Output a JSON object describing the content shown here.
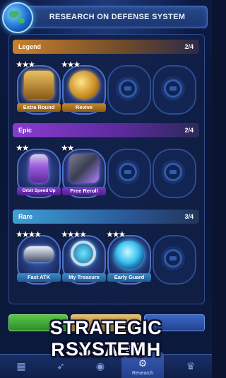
{
  "header": {
    "title": "RESEARCH ON DEFENSE SYSTEM"
  },
  "sections": [
    {
      "name": "Legend",
      "count": "2/4",
      "slots": [
        {
          "label": "Extra Round",
          "stars": "★★★",
          "icon": "treasure-chest-icon"
        },
        {
          "label": "Revive",
          "stars": "★★★",
          "icon": "golden-orb-icon"
        },
        {
          "label": "",
          "stars": "",
          "icon": "locked-slot-icon"
        },
        {
          "label": "",
          "stars": "",
          "icon": "locked-slot-icon"
        }
      ]
    },
    {
      "name": "Epic",
      "count": "2/4",
      "slots": [
        {
          "label": "Orbit Speed Up",
          "stars": "★★",
          "icon": "energy-capsule-icon"
        },
        {
          "label": "Free Reroll",
          "stars": "★★",
          "icon": "device-icon"
        },
        {
          "label": "",
          "stars": "",
          "icon": "locked-slot-icon"
        },
        {
          "label": "",
          "stars": "",
          "icon": "locked-slot-icon"
        }
      ]
    },
    {
      "name": "Rare",
      "count": "3/4",
      "slots": [
        {
          "label": "Fast ATK",
          "stars": "★★★★",
          "icon": "cannon-icon"
        },
        {
          "label": "My Treasure",
          "stars": "★★★★",
          "icon": "magnifier-icon"
        },
        {
          "label": "Early Guard",
          "stars": "★★★",
          "icon": "shield-orb-icon"
        },
        {
          "label": "",
          "stars": "",
          "icon": "locked-slot-icon"
        }
      ]
    }
  ],
  "promo": {
    "line1": "STRATEGIC RESEARCH",
    "line2": "SYSTEM"
  },
  "tabbar": {
    "active_label": "Research"
  },
  "colors": {
    "legend": "#c9812a",
    "epic": "#8a3bd0",
    "rare": "#3fa0d6"
  }
}
